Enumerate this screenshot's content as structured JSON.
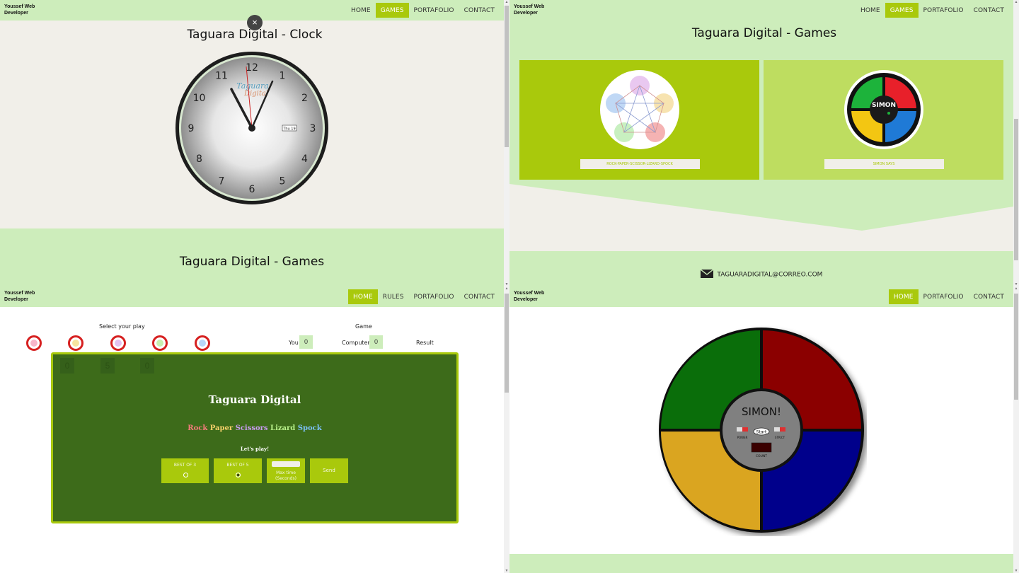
{
  "brand": {
    "line1": "Youssef Web",
    "line2": "Developer"
  },
  "nav_clock": [
    "HOME",
    "GAMES",
    "PORTAFOLIO",
    "CONTACT"
  ],
  "nav_clock_active": "GAMES",
  "nav_games": [
    "HOME",
    "GAMES",
    "PORTAFOLIO",
    "CONTACT"
  ],
  "nav_rps": [
    "HOME",
    "RULES",
    "PORTAFOLIO",
    "CONTACT"
  ],
  "nav_simon": [
    "HOME",
    "PORTAFOLIO",
    "CONTACT"
  ],
  "clock": {
    "title": "Taguara Digital - Clock",
    "close": "×",
    "numbers": [
      "12",
      "1",
      "2",
      "3",
      "4",
      "5",
      "6",
      "7",
      "8",
      "9",
      "10",
      "11"
    ],
    "logo_line1": "Taguara",
    "logo_line2": "Digital",
    "date": "Thu 19"
  },
  "games_title_lower": "Taguara Digital - Games",
  "games": {
    "title": "Taguara Digital - Games",
    "cards": [
      {
        "label": "ROCK-PAPER-SCISSOR-LIZARD-SPOCK"
      },
      {
        "label": "SIMON SAYS"
      }
    ],
    "simon_logo": "SIMON",
    "contact_email": "TAGUARADIGITAL@CORREO.COM"
  },
  "rps": {
    "select_label": "Select your play",
    "game_label": "Game",
    "you_label": "You",
    "you_score": "0",
    "computer_label": "Computer",
    "computer_score": "0",
    "result_label": "Result",
    "ghost_values": [
      "0",
      "5",
      "0"
    ],
    "board_title": "Taguara Digital",
    "subtitle_words": [
      "Rock",
      "Paper",
      "Scissors",
      "Lizard",
      "Spock"
    ],
    "subtitle_colors": [
      "#f47c7c",
      "#f7d06b",
      "#c89bf0",
      "#b8f08a",
      "#7cc0f7"
    ],
    "lets_play": "Let's play!",
    "best_of_3": "BEST OF 3",
    "best_of_5": "BEST OF 5",
    "max_time": "Max time",
    "seconds": "(Seconds)",
    "send": "Send"
  },
  "simon": {
    "title": "SIMON!",
    "start": "Start",
    "power": "POWER",
    "strict": "STRICT",
    "count": "COUNT",
    "colors": {
      "green": "#0a6e0a",
      "red": "#8b0000",
      "yellow": "#daa520",
      "blue": "#00008b"
    }
  }
}
